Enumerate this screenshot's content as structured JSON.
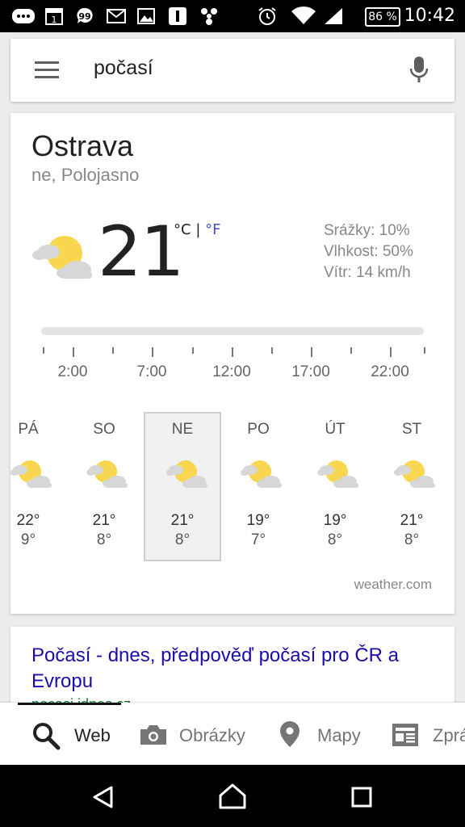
{
  "status_bar": {
    "time": "10:42",
    "battery": "86 %",
    "notification_icons": [
      "chat-icon",
      "calendar-icon",
      "messaging-icon",
      "gmail-icon",
      "gallery-icon",
      "app-icon",
      "fan-icon"
    ],
    "status_icons": [
      "alarm-icon",
      "wifi-icon",
      "signal-icon",
      "battery-icon"
    ]
  },
  "search": {
    "query": "počasí",
    "menu_icon": "menu-icon",
    "mic_icon": "mic-icon"
  },
  "weather": {
    "city": "Ostrava",
    "condition": "ne, Polojasno",
    "temperature": "21",
    "unit_c": "°C",
    "unit_sep": "|",
    "unit_f": "°F",
    "current_icon": "partly-cloudy-icon",
    "details": {
      "precipitation": "Srážky: 10%",
      "humidity": "Vlhkost: 50%",
      "wind": "Vítr: 14 km/h"
    },
    "timeline_labels": [
      "2:00",
      "7:00",
      "12:00",
      "17:00",
      "22:00"
    ],
    "days": [
      {
        "name": "PÁ",
        "high": "22°",
        "low": "9°",
        "icon": "partly-cloudy-icon"
      },
      {
        "name": "SO",
        "high": "21°",
        "low": "8°",
        "icon": "partly-cloudy-icon"
      },
      {
        "name": "NE",
        "high": "21°",
        "low": "8°",
        "icon": "partly-cloudy-icon",
        "selected": true
      },
      {
        "name": "PO",
        "high": "19°",
        "low": "7°",
        "icon": "partly-cloudy-icon"
      },
      {
        "name": "ÚT",
        "high": "19°",
        "low": "8°",
        "icon": "partly-cloudy-icon"
      },
      {
        "name": "ST",
        "high": "21°",
        "low": "8°",
        "icon": "partly-cloudy-icon"
      }
    ],
    "source": "weather.com"
  },
  "result": {
    "title": "Počasí - dnes, předpověď počasí pro ČR a Evropu",
    "url": "pocasi.idnes.cz"
  },
  "tabs": [
    {
      "label": "Web",
      "icon": "search-icon",
      "active": true
    },
    {
      "label": "Obrázky",
      "icon": "camera-icon"
    },
    {
      "label": "Mapy",
      "icon": "map-pin-icon"
    },
    {
      "label": "Zprávy",
      "icon": "newspaper-icon"
    }
  ],
  "nav": [
    "back-icon",
    "home-icon",
    "recents-icon"
  ]
}
